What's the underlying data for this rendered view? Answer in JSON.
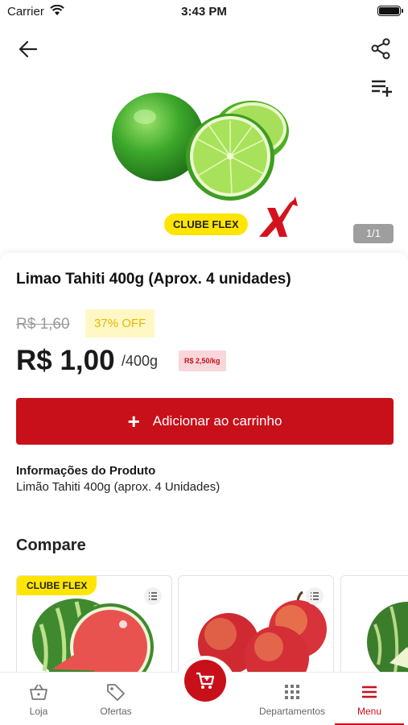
{
  "status_bar": {
    "carrier": "Carrier",
    "time": "3:43 PM"
  },
  "hero": {
    "badge": "CLUBE FLEX",
    "pager": "1/1"
  },
  "product": {
    "title": "Limao Tahiti 400g (Aprox. 4 unidades)",
    "old_price": "R$ 1,60",
    "discount": "37% OFF",
    "price": "R$ 1,00",
    "unit": "/400g",
    "price_per_kg": "R$ 2,50/kg",
    "add_button": "Adicionar ao carrinho",
    "info_title": "Informações do Produto",
    "info_text": "Limão Tahiti 400g (aprox. 4 Unidades)"
  },
  "compare": {
    "title": "Compare",
    "cards": [
      {
        "badge": "CLUBE FLEX",
        "image": "watermelon"
      },
      {
        "badge": "",
        "image": "red-apples"
      },
      {
        "badge": "",
        "image": "melon"
      }
    ]
  },
  "bottom_nav": {
    "items": [
      {
        "label": "Loja",
        "icon": "basket-icon"
      },
      {
        "label": "Ofertas",
        "icon": "tag-icon"
      },
      {
        "label": "Departamentos",
        "icon": "grid-icon"
      },
      {
        "label": "Menu",
        "icon": "hamburger-icon"
      }
    ],
    "active": "Menu",
    "center": "cart-icon"
  },
  "colors": {
    "primary": "#c8101a",
    "badge_yellow": "#ffe500",
    "discount_text": "#e8b800"
  }
}
